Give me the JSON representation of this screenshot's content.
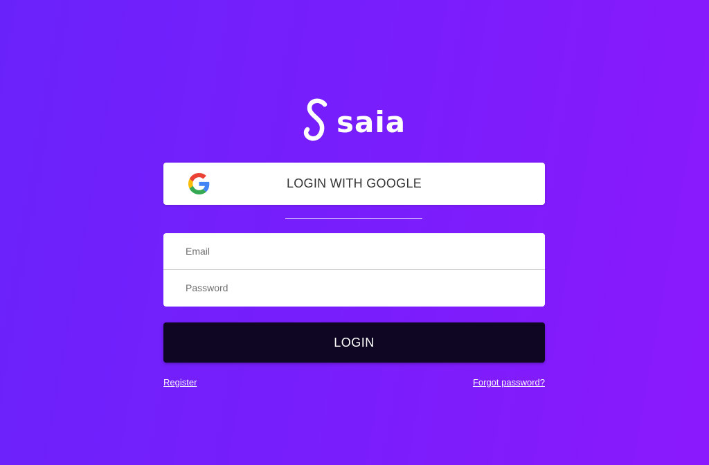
{
  "brand": {
    "name": "saia",
    "logo_icon": "script-s-icon"
  },
  "google_button": {
    "label": "LOGIN WITH GOOGLE",
    "icon": "google-icon"
  },
  "form": {
    "email": {
      "placeholder": "Email",
      "value": ""
    },
    "password": {
      "placeholder": "Password",
      "value": ""
    }
  },
  "login_button": {
    "label": "LOGIN"
  },
  "links": {
    "register": "Register",
    "forgot_password": "Forgot password?"
  },
  "colors": {
    "background_start": "#6a22fb",
    "background_end": "#8b19fd",
    "login_button": "#0e0622",
    "card": "#ffffff"
  }
}
